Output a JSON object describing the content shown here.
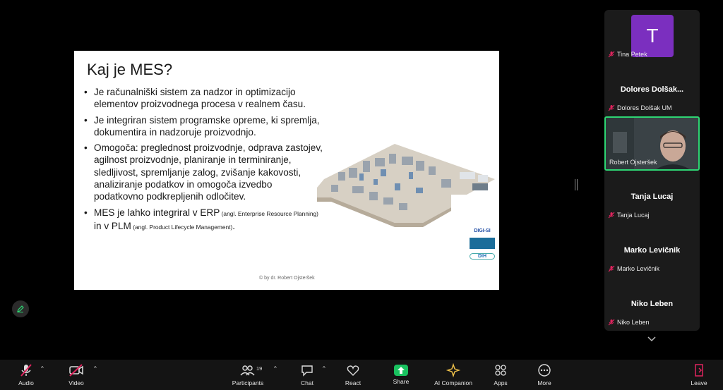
{
  "slide": {
    "title": "Kaj je MES?",
    "bullets": [
      {
        "text": "Je računalniški sistem za nadzor in optimizacijo elementov proizvodnega procesa v realnem času."
      },
      {
        "text": "Je integriran sistem programske opreme, ki spremlja, dokumentira in nadzoruje proizvodnjo."
      },
      {
        "text": "Omogoča: preglednost proizvodnje, odprava zastojev, agilnost proizvodnje, planiranje in terminiranje, sledljivost, spremljanje zalog, zvišanje kakovosti, analiziranje podatkov in omogoča izvedbo podatkovno podkrepljenih odločitev."
      },
      {
        "text_a": "MES je lahko integriral v ERP",
        "small_a": " (angl. Enterprise Resource Planning)",
        "text_b": " in v PLM",
        "small_b": " (angl. Product Lifecycle Management)",
        "text_c": "."
      }
    ],
    "copyright": "© by dr. Robert Ojsteršek",
    "logos": [
      "DIGI-SI",
      "",
      "DIH"
    ]
  },
  "participants": {
    "tiles": [
      {
        "name": "Tina Petek",
        "avatar_letter": "T",
        "muted": true
      },
      {
        "display": "Dolores  Dolšak...",
        "name": "Dolores Dolšak UM",
        "muted": true
      },
      {
        "name": "Robert Ojsteršek",
        "video": true,
        "active_speaker": true
      },
      {
        "display": "Tanja Lucaj",
        "name": "Tanja Lucaj",
        "muted": true
      },
      {
        "display": "Marko Levičnik",
        "name": "Marko Levičnik",
        "muted": true
      },
      {
        "display": "Niko Leben",
        "name": "Niko Leben",
        "muted": true
      }
    ]
  },
  "toolbar": {
    "audio": "Audio",
    "video": "Video",
    "participants": "Participants",
    "participants_count": "19",
    "chat": "Chat",
    "react": "React",
    "share": "Share",
    "ai": "AI Companion",
    "apps": "Apps",
    "more": "More",
    "leave": "Leave"
  },
  "colors": {
    "share_green": "#19c15f",
    "active_speaker_border": "#2ed573",
    "avatar_purple": "#7b2fbf",
    "mute_red": "#e0245e"
  }
}
